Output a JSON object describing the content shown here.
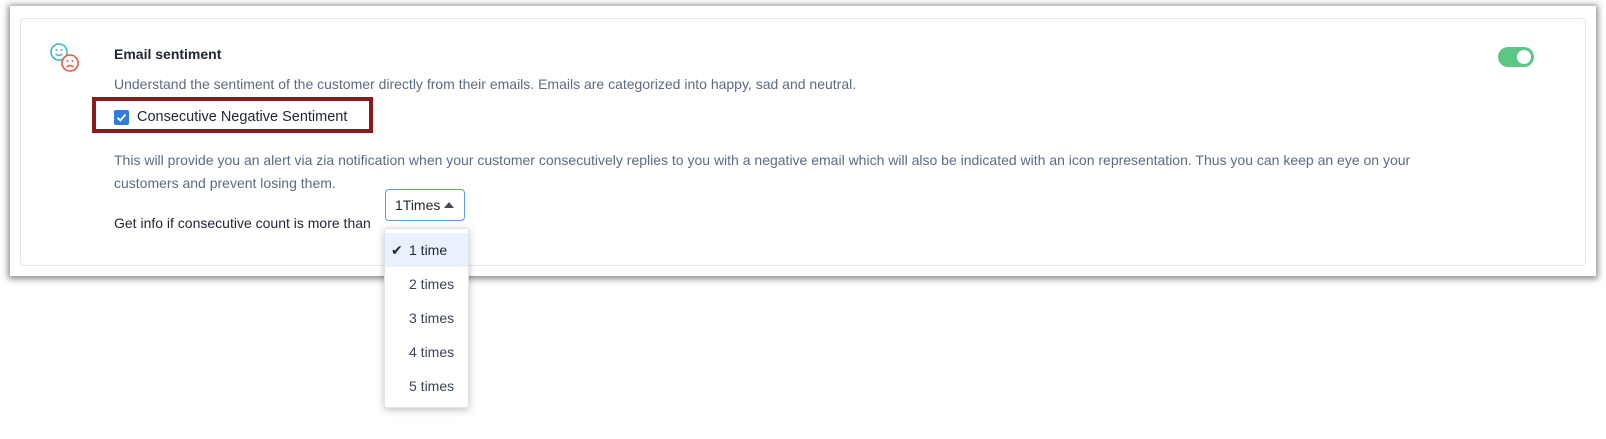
{
  "section": {
    "title": "Email sentiment",
    "description": "Understand the sentiment of the customer directly from their emails. Emails are categorized into happy, sad and neutral.",
    "icon": "sentiment-faces-icon",
    "toggle_enabled": true,
    "colors": {
      "toggle_on": "#5cc785",
      "happy_face": "#3bb8c9",
      "sad_face": "#e05a47",
      "highlight_border": "#8b1a1a",
      "checkbox": "#2f7de1"
    }
  },
  "option": {
    "checkbox_label": "Consecutive Negative Sentiment",
    "checked": true,
    "info": "This will provide you an alert via zia notification when your customer consecutively replies to you with a negative email which will also be indicated with an icon representation. Thus you can keep an eye on your customers and prevent losing them."
  },
  "count": {
    "label": "Get info if consecutive count is more than",
    "selected_value": "1Times",
    "options": [
      "1 time",
      "2 times",
      "3 times",
      "4 times",
      "5 times"
    ],
    "selected_index": 0
  }
}
